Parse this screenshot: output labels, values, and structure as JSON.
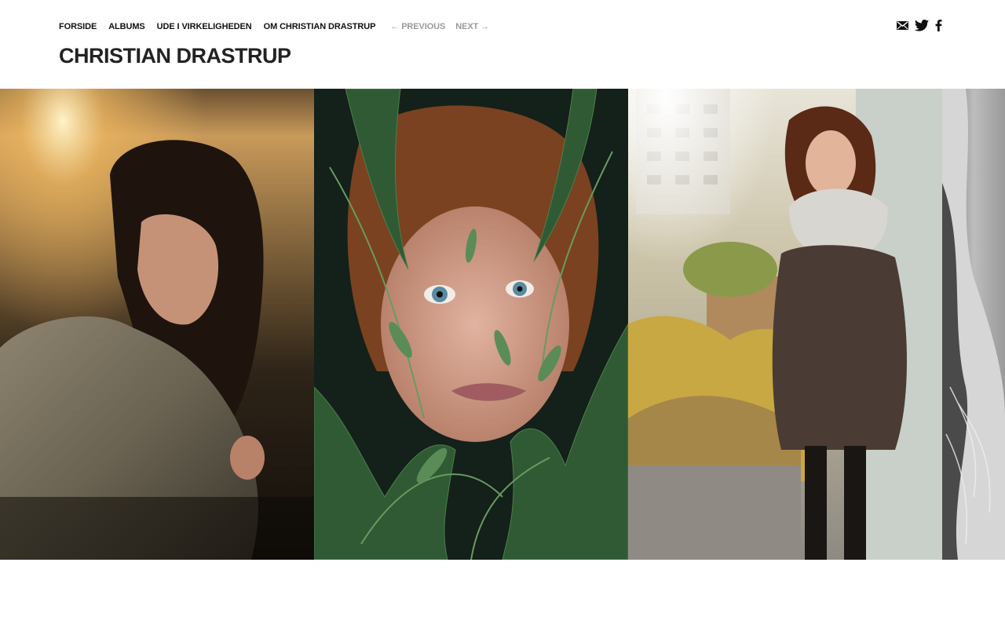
{
  "nav": {
    "items": [
      {
        "label": "FORSIDE"
      },
      {
        "label": "ALBUMS"
      },
      {
        "label": "UDE I VIRKELIGHEDEN"
      },
      {
        "label": "OM CHRISTIAN DRASTRUP"
      }
    ],
    "previous_label": "← PREVIOUS",
    "next_label": "NEXT →"
  },
  "site": {
    "title": "CHRISTIAN DRASTRUP"
  },
  "social": {
    "icons": [
      "email-icon",
      "twitter-icon",
      "facebook-icon"
    ]
  },
  "gallery": {
    "photos": [
      {
        "subject": "woman-sweater-sunset"
      },
      {
        "subject": "redhead-in-plants"
      },
      {
        "subject": "woman-scarf-rooftop"
      },
      {
        "subject": "bw-partial-portrait"
      }
    ]
  },
  "colors": {
    "text": "#111111",
    "muted": "#9a9a9a",
    "title": "#222222",
    "background": "#ffffff"
  }
}
